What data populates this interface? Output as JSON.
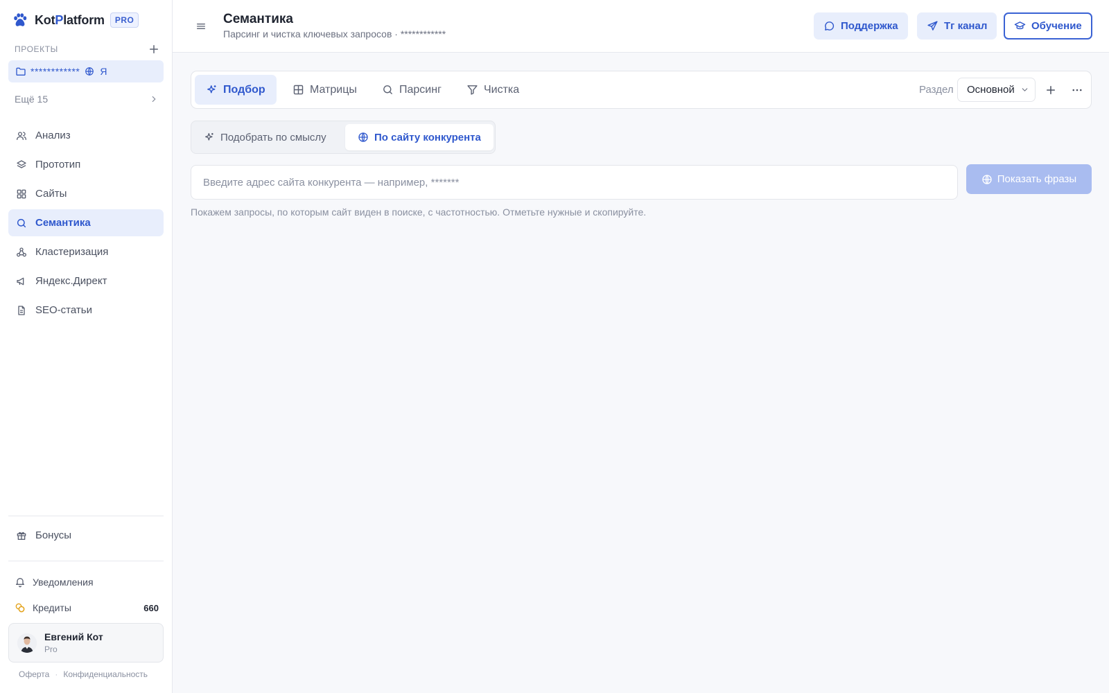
{
  "app": {
    "logo_part1": "Kot",
    "logo_part2": "P",
    "logo_part3": "latform",
    "badge": "PRO",
    "accent_color": "#2f58cd"
  },
  "sidebar": {
    "projects_header": "ПРОЕКТЫ",
    "project": {
      "name": "************",
      "engine_letter": "Я"
    },
    "more_label": "Ещё 15",
    "nav": [
      {
        "label": "Анализ",
        "icon": "users-icon"
      },
      {
        "label": "Прототип",
        "icon": "layers-icon"
      },
      {
        "label": "Сайты",
        "icon": "grid-icon"
      },
      {
        "label": "Семантика",
        "icon": "search-icon",
        "active": true
      },
      {
        "label": "Кластеризация",
        "icon": "cluster-icon"
      },
      {
        "label": "Яндекс.Директ",
        "icon": "megaphone-icon"
      },
      {
        "label": "SEO-статьи",
        "icon": "document-icon"
      }
    ],
    "bonus_label": "Бонусы",
    "notifications_label": "Уведомления",
    "credits_label": "Кредиты",
    "credits_value": "660",
    "user": {
      "name": "Евгений Кот",
      "plan": "Pro"
    },
    "legal": {
      "offer": "Оферта",
      "privacy": "Конфиденциальность"
    }
  },
  "header": {
    "title": "Семантика",
    "subtitle": "Парсинг и чистка ключевых запросов · ************",
    "buttons": {
      "support": "Поддержка",
      "tg": "Tг канал",
      "learn": "Обучение"
    }
  },
  "tabs": {
    "items": [
      {
        "label": "Подбор",
        "icon": "sparkles-icon",
        "active": true
      },
      {
        "label": "Матрицы",
        "icon": "table-icon"
      },
      {
        "label": "Парсинг",
        "icon": "search-icon"
      },
      {
        "label": "Чистка",
        "icon": "filter-icon"
      }
    ],
    "section_label": "Раздел",
    "section_value": "Основной"
  },
  "subtabs": {
    "by_meaning": "Подобрать по смыслу",
    "by_competitor": "По сайту конкурента"
  },
  "search": {
    "placeholder": "Введите адрес сайта конкурента — например, *******",
    "value": "",
    "button": "Показать фразы",
    "hint": "Покажем запросы, по которым сайт виден в поиске, с частотностью. Отметьте нужные и скопируйте."
  }
}
